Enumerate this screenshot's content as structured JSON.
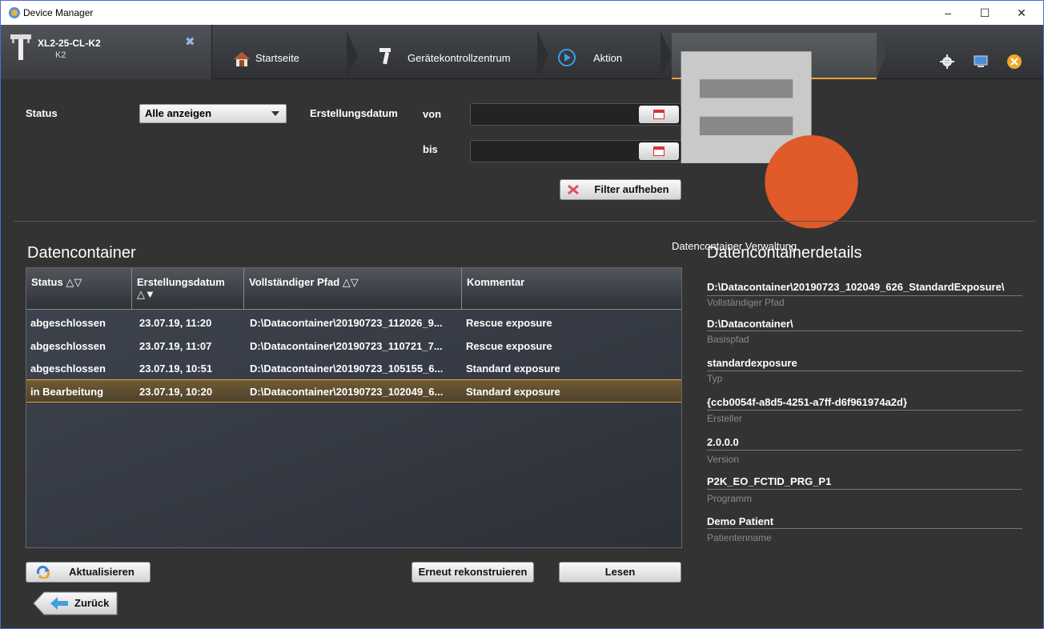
{
  "window": {
    "title": "Device Manager",
    "minimize": "–",
    "maximize": "☐",
    "close": "✕"
  },
  "device": {
    "name": "XL2-25-CL-K2",
    "sub": "K2"
  },
  "nav": {
    "home": "Startseite",
    "control_center": "Gerätekontrollzentrum",
    "action": "Aktion",
    "data_container_admin": "Datencontainer Verwaltung"
  },
  "filter": {
    "status_label": "Status",
    "status_value": "Alle anzeigen",
    "date_label": "Erstellungsdatum",
    "from_label": "von",
    "to_label": "bis",
    "from_value": "",
    "to_value": "",
    "clear_button": "Filter aufheben"
  },
  "table": {
    "title": "Datencontainer",
    "columns": [
      "Status △▽",
      "Erstellungsdatum △▼",
      "Vollständiger Pfad △▽",
      "Kommentar"
    ],
    "rows": [
      {
        "status": "abgeschlossen",
        "date": "23.07.19, 11:20",
        "path": "D:\\Datacontainer\\20190723_112026_9...",
        "comment": "Rescue exposure"
      },
      {
        "status": "abgeschlossen",
        "date": "23.07.19, 11:07",
        "path": "D:\\Datacontainer\\20190723_110721_7...",
        "comment": "Rescue exposure"
      },
      {
        "status": "abgeschlossen",
        "date": "23.07.19, 10:51",
        "path": "D:\\Datacontainer\\20190723_105155_6...",
        "comment": "Standard exposure"
      },
      {
        "status": "in Bearbeitung",
        "date": "23.07.19, 10:20",
        "path": "D:\\Datacontainer\\20190723_102049_6...",
        "comment": "Standard exposure"
      }
    ]
  },
  "details": {
    "title": "Datencontainerdetails",
    "fields": [
      {
        "value": "D:\\Datacontainer\\20190723_102049_626_StandardExposure\\",
        "label": "Vollständiger Pfad"
      },
      {
        "value": "D:\\Datacontainer\\",
        "label": "Basispfad"
      },
      {
        "value": "standardexposure",
        "label": "Typ"
      },
      {
        "value": "{ccb0054f-a8d5-4251-a7ff-d6f961974a2d}",
        "label": "Ersteller"
      },
      {
        "value": "2.0.0.0",
        "label": "Version"
      },
      {
        "value": "P2K_EO_FCTID_PRG_P1",
        "label": "Programm"
      },
      {
        "value": "Demo Patient",
        "label": "Patientenname"
      }
    ]
  },
  "buttons": {
    "refresh": "Aktualisieren",
    "reconstruct": "Erneut rekonstruieren",
    "read": "Lesen",
    "back": "Zurück"
  },
  "colors": {
    "accent": "#e7a43a",
    "window_border": "#4a6fd0",
    "background": "#333333"
  },
  "icons": [
    "app-icon",
    "device-icon",
    "close-device-icon",
    "home-icon",
    "control-center-icon",
    "action-icon",
    "data-container-icon",
    "settings-icon",
    "monitor-icon",
    "exit-icon",
    "calendar-icon",
    "clear-filter-icon",
    "refresh-icon",
    "back-arrow-icon"
  ]
}
